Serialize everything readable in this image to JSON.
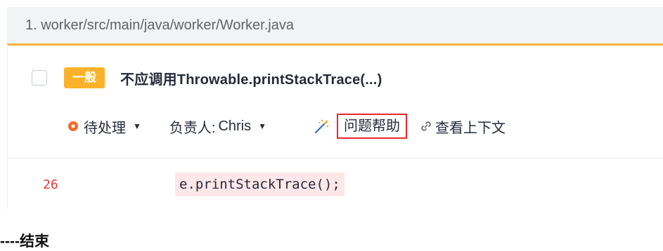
{
  "file": {
    "path": "1. worker/src/main/java/worker/Worker.java"
  },
  "issue": {
    "severity": "一般",
    "title": "不应调用Throwable.printStackTrace(...)",
    "status": "待处理",
    "owner_label": "负责人:",
    "owner_name": "Chris",
    "help_label": "问题帮助",
    "context_label": "查看上下文",
    "colors": {
      "severity": "#fbb22a",
      "status": "#f26b28",
      "highlight_border": "#e8272d"
    },
    "icons": [
      "status-dot-icon",
      "caret-down-icon",
      "magic-wand-icon",
      "link-icon"
    ]
  },
  "code": {
    "line_number": "26",
    "text": "e.printStackTrace();"
  },
  "footer": {
    "end_text": "----结束"
  }
}
